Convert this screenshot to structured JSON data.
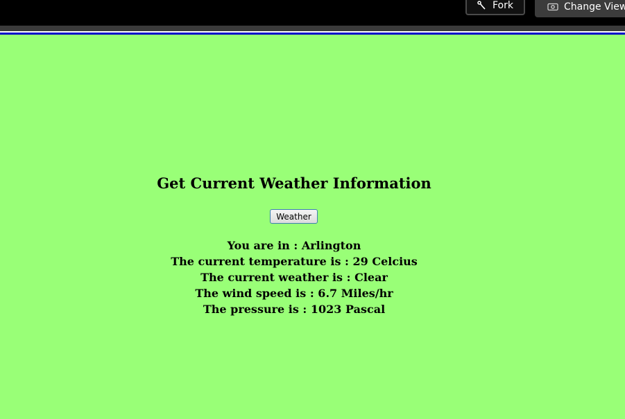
{
  "toolbar": {
    "fork_label": "Fork",
    "fork_icon": "fork-icon",
    "change_view_label": "Change View",
    "change_view_icon": "eye-icon"
  },
  "main": {
    "heading": "Get Current Weather Information",
    "weather_button_label": "Weather",
    "info_lines": [
      "You are in : Arlington",
      "The current temperature is : 29 Celcius",
      "The current weather is : Clear",
      "The wind speed is : 6.7 Miles/hr",
      "The pressure is : 1023 Pascal"
    ]
  },
  "colors": {
    "page_background": "#99ff77",
    "topbar_background": "#000000",
    "accent_line": "#0000c8"
  }
}
